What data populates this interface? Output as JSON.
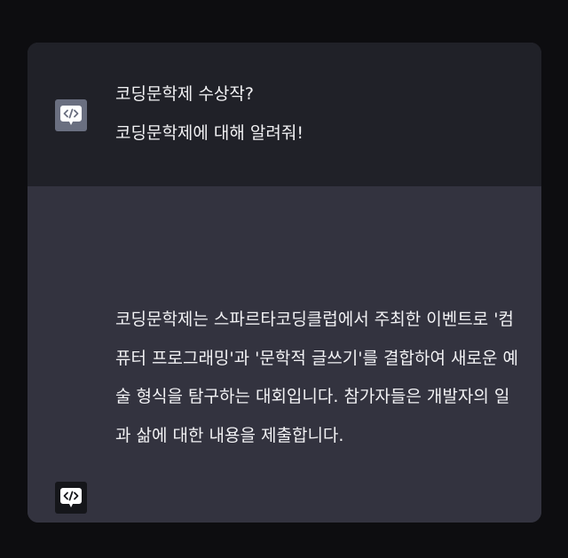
{
  "conversation": {
    "messages": [
      {
        "role": "user",
        "avatar_icon": "code-chat-bubble-icon",
        "text": "코딩문학제 수상작?\n코딩문학제에 대해 알려줘!"
      },
      {
        "role": "assistant",
        "avatar_icon": "code-chat-bubble-icon",
        "text": "코딩문학제는 스파르타코딩클럽에서 주최한 이벤트로 '컴퓨터 프로그래밍'과 '문학적 글쓰기'를 결합하여 새로운 예술 형식을 탐구하는 대회입니다. 참가자들은 개발자의 일과 삶에 대한 내용을 제출합니다."
      }
    ]
  },
  "colors": {
    "page_background": "#0d0d10",
    "user_message_background": "#202128",
    "assistant_message_background": "#33333f",
    "text": "#f2f2f4",
    "user_avatar_background": "#6a6f80",
    "assistant_avatar_background": "#15161a"
  }
}
